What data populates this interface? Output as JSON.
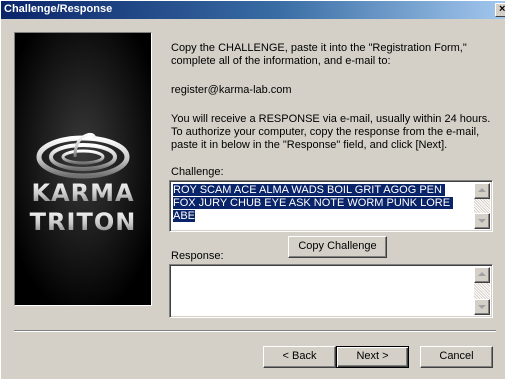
{
  "window": {
    "title": "Challenge/Response",
    "close_label": "×"
  },
  "logo": {
    "line1": "KARMA",
    "line2": "TRITON"
  },
  "instructions": {
    "paragraph1": "Copy the CHALLENGE, paste it into the \"Registration Form,\"\ncomplete all of the information, and e-mail to:",
    "email": "register@karma-lab.com",
    "paragraph2": "You will receive a RESPONSE via e-mail, usually within 24 hours.\nTo authorize your computer, copy the response from the e-mail,\npaste it in below in the \"Response\" field, and click [Next]."
  },
  "challenge": {
    "label": "Challenge:",
    "value": "ROY SCAM ACE ALMA WADS BOIL GRIT AGOG PEN FOX JURY CHUB EYE ASK NOTE WORM PUNK LORE ABE"
  },
  "copy_button_label": "Copy Challenge",
  "response": {
    "label": "Response:",
    "value": ""
  },
  "footer": {
    "back_label": "< Back",
    "next_label": "Next >",
    "cancel_label": "Cancel"
  },
  "colors": {
    "titlebar_start": "#0a246a",
    "titlebar_end": "#a6caf0",
    "selection": "#0a246a",
    "dialog_face": "#d4d0c8"
  }
}
